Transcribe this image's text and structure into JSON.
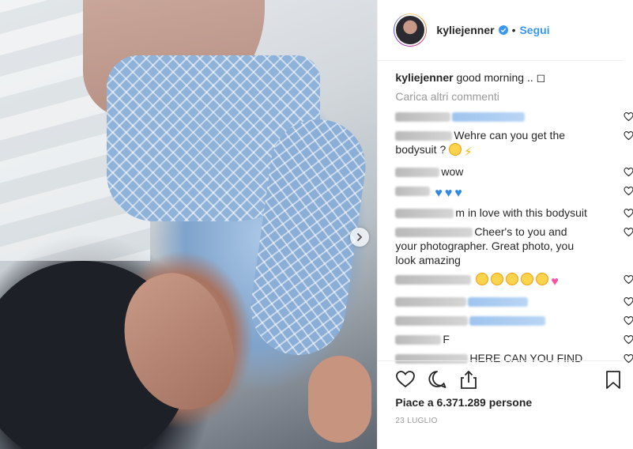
{
  "post": {
    "username": "kyliejenner",
    "follow_label": "Segui",
    "separator": "•",
    "caption_user": "kyliejenner",
    "caption_text": "good morning .. ◻",
    "load_more": "Carica altri commenti",
    "likes": "Piace a 6.371.289 persone",
    "date": "23 LUGLIO"
  },
  "comments": [
    {
      "text": "",
      "user_w": 70,
      "extra_w": 92,
      "extra_blue": true
    },
    {
      "text": "Wehre can you get the",
      "text2": "bodysuit ?",
      "emojis": [
        "love",
        "bolt"
      ],
      "user_w": 72
    },
    {
      "text": "wow",
      "user_w": 56
    },
    {
      "text": "",
      "user_w": 44,
      "emojis": [
        "blueheart",
        "blueheart",
        "blueheart"
      ]
    },
    {
      "text": "m in love with this bodysuit",
      "user_w": 74
    },
    {
      "text": "Cheer's to you and",
      "text2": "your photographer. Great photo, you",
      "text3": "look amazing",
      "user_w": 98
    },
    {
      "text": "",
      "user_w": 96,
      "emojis": [
        "love",
        "love",
        "love",
        "love",
        "love",
        "pinkheart"
      ]
    },
    {
      "text": "",
      "user_w": 90,
      "extra_w": 76,
      "extra_blue": true
    },
    {
      "text": "",
      "user_w": 92,
      "extra_w": 96,
      "extra_blue": true
    },
    {
      "text": "F",
      "user_w": 58
    },
    {
      "text": "HERE CAN YOU FIND",
      "user_w": 92
    }
  ],
  "icons": {
    "like": "heart-icon",
    "comment": "comment-icon",
    "share": "share-icon",
    "save": "bookmark-icon",
    "next": "chevron-right-icon",
    "verified": "verified-badge-icon"
  },
  "colors": {
    "accent": "#3897f0",
    "text": "#262626",
    "muted": "#999999",
    "divider": "#efefef"
  }
}
